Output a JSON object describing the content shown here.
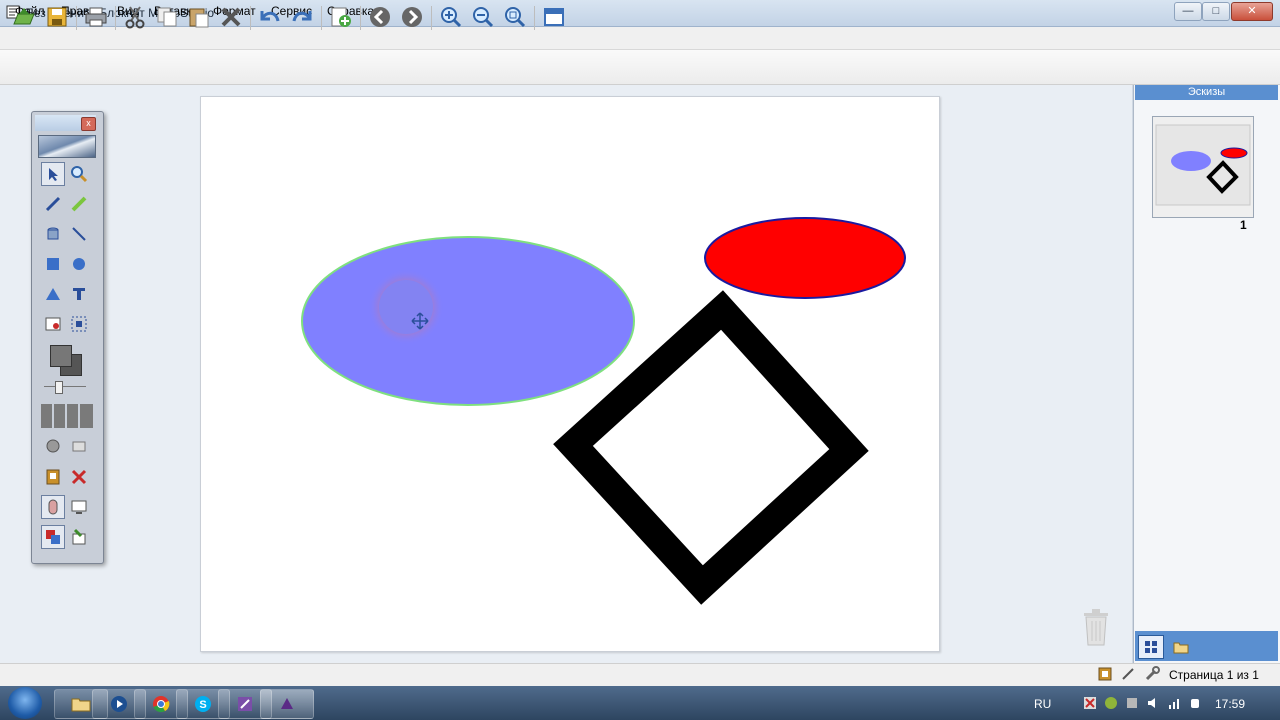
{
  "window": {
    "title": "Без имени* - Блокнот MimioStudio",
    "minimize": "—",
    "maximize": "□",
    "close": "✕"
  },
  "menu": [
    "Файл",
    "Правка",
    "Вид",
    "Вставка",
    "Формат",
    "Сервис",
    "Справка"
  ],
  "toolbar_icons": [
    "open-icon",
    "save-icon",
    "print-icon",
    "cut-icon",
    "copy-icon",
    "paste-icon",
    "delete-icon",
    "undo-icon",
    "redo-icon",
    "add-page-icon",
    "back-icon",
    "forward-icon",
    "zoom-in-icon",
    "zoom-out-icon",
    "zoom-fit-icon",
    "view-icon"
  ],
  "palette": {
    "close": "x"
  },
  "thumbnails": {
    "header": "Эскизы",
    "page_number": "1"
  },
  "status": {
    "page": "Страница 1 из 1"
  },
  "taskbar": {
    "lang": "RU",
    "time": "17:59"
  },
  "colors": {
    "ellipse_fill": "#8080ff",
    "ellipse_stroke": "#7fe07f",
    "red_fill": "#ff0000",
    "red_stroke": "#1a1aa0",
    "diamond": "#000000"
  }
}
